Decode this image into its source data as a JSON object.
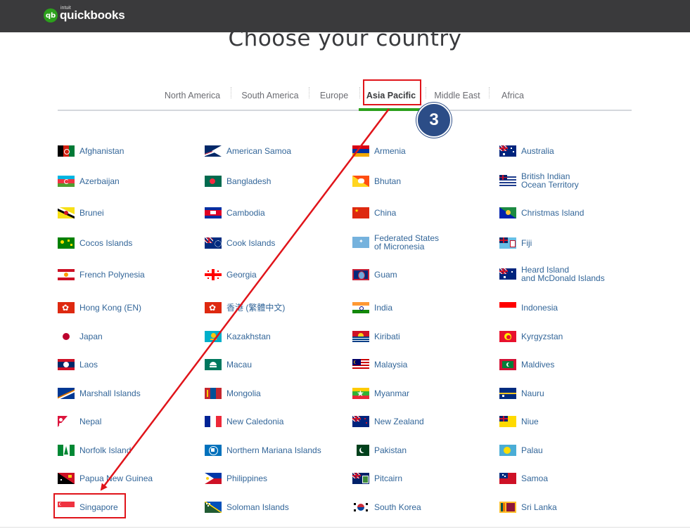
{
  "header": {
    "logo_intuit": "intuit",
    "logo_text": "quickbooks",
    "logo_badge": "qb"
  },
  "page": {
    "title": "Choose your country"
  },
  "tabs": [
    {
      "label": "North America"
    },
    {
      "label": "South America"
    },
    {
      "label": "Europe"
    },
    {
      "label": "Asia Pacific",
      "active": true
    },
    {
      "label": "Middle East"
    },
    {
      "label": "Africa"
    }
  ],
  "annotation": {
    "step": "3",
    "highlight_color": "#e0141a",
    "badge_color": "#2c4d87"
  },
  "colors": {
    "brand_green": "#2ca01c",
    "link": "#336699",
    "topbar": "#3a3a3c"
  },
  "countries": [
    {
      "name": "Afghanistan",
      "flag": "afghanistan-flag"
    },
    {
      "name": "American Samoa",
      "flag": "american-samoa-flag"
    },
    {
      "name": "Armenia",
      "flag": "armenia-flag"
    },
    {
      "name": "Australia",
      "flag": "australia-flag"
    },
    {
      "name": "Azerbaijan",
      "flag": "azerbaijan-flag"
    },
    {
      "name": "Bangladesh",
      "flag": "bangladesh-flag"
    },
    {
      "name": "Bhutan",
      "flag": "bhutan-flag"
    },
    {
      "name": "British Indian",
      "name2": "Ocean Territory",
      "flag": "british-indian-ocean-territory-flag"
    },
    {
      "name": "Brunei",
      "flag": "brunei-flag"
    },
    {
      "name": "Cambodia",
      "flag": "cambodia-flag"
    },
    {
      "name": "China",
      "flag": "china-flag"
    },
    {
      "name": "Christmas Island",
      "flag": "christmas-island-flag"
    },
    {
      "name": "Cocos Islands",
      "flag": "cocos-islands-flag"
    },
    {
      "name": "Cook Islands",
      "flag": "cook-islands-flag"
    },
    {
      "name": "Federated States",
      "name2": "of Micronesia",
      "flag": "micronesia-flag"
    },
    {
      "name": "Fiji",
      "flag": "fiji-flag"
    },
    {
      "name": "French Polynesia",
      "flag": "french-polynesia-flag"
    },
    {
      "name": "Georgia",
      "flag": "georgia-flag"
    },
    {
      "name": "Guam",
      "flag": "guam-flag"
    },
    {
      "name": "Heard Island",
      "name2": "and McDonald Islands",
      "flag": "heard-island-flag"
    },
    {
      "name": "Hong Kong (EN)",
      "flag": "hong-kong-flag"
    },
    {
      "name": "香港 (繁體中文)",
      "flag": "hong-kong-flag"
    },
    {
      "name": "India",
      "flag": "india-flag"
    },
    {
      "name": "Indonesia",
      "flag": "indonesia-flag"
    },
    {
      "name": "Japan",
      "flag": "japan-flag"
    },
    {
      "name": "Kazakhstan",
      "flag": "kazakhstan-flag"
    },
    {
      "name": "Kiribati",
      "flag": "kiribati-flag"
    },
    {
      "name": "Kyrgyzstan",
      "flag": "kyrgyzstan-flag"
    },
    {
      "name": "Laos",
      "flag": "laos-flag"
    },
    {
      "name": "Macau",
      "flag": "macau-flag"
    },
    {
      "name": "Malaysia",
      "flag": "malaysia-flag"
    },
    {
      "name": "Maldives",
      "flag": "maldives-flag"
    },
    {
      "name": "Marshall Islands",
      "flag": "marshall-islands-flag"
    },
    {
      "name": "Mongolia",
      "flag": "mongolia-flag"
    },
    {
      "name": "Myanmar",
      "flag": "myanmar-flag"
    },
    {
      "name": "Nauru",
      "flag": "nauru-flag"
    },
    {
      "name": "Nepal",
      "flag": "nepal-flag"
    },
    {
      "name": "New Caledonia",
      "flag": "new-caledonia-flag"
    },
    {
      "name": "New Zealand",
      "flag": "new-zealand-flag"
    },
    {
      "name": "Niue",
      "flag": "niue-flag"
    },
    {
      "name": "Norfolk Island",
      "flag": "norfolk-island-flag"
    },
    {
      "name": "Northern Mariana Islands",
      "flag": "northern-mariana-islands-flag"
    },
    {
      "name": "Pakistan",
      "flag": "pakistan-flag"
    },
    {
      "name": "Palau",
      "flag": "palau-flag"
    },
    {
      "name": "Papua New Guinea",
      "flag": "papua-new-guinea-flag"
    },
    {
      "name": "Philippines",
      "flag": "philippines-flag"
    },
    {
      "name": "Pitcairn",
      "flag": "pitcairn-flag"
    },
    {
      "name": "Samoa",
      "flag": "samoa-flag"
    },
    {
      "name": "Singapore",
      "flag": "singapore-flag",
      "highlighted": true
    },
    {
      "name": "Soloman Islands",
      "flag": "solomon-islands-flag"
    },
    {
      "name": "South Korea",
      "flag": "south-korea-flag"
    },
    {
      "name": "Sri Lanka",
      "flag": "sri-lanka-flag"
    }
  ]
}
